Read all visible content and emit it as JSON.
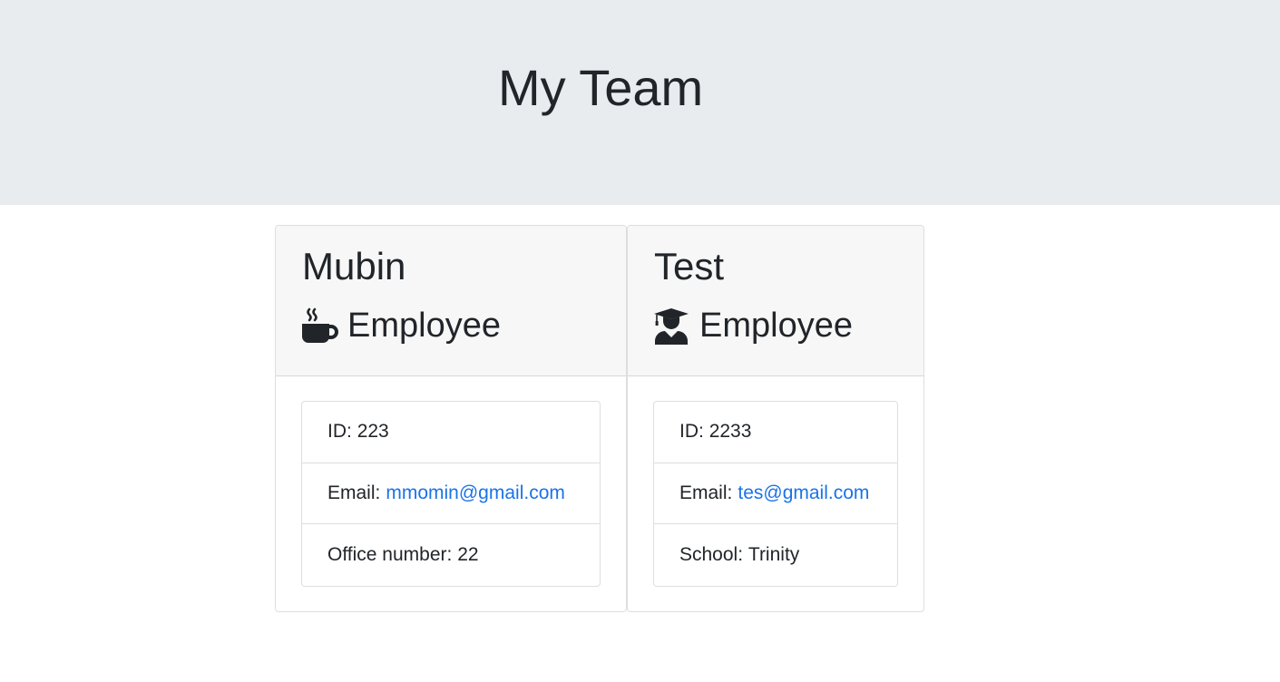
{
  "header": {
    "title": "My Team",
    "background": "#e9ecef"
  },
  "cards": [
    {
      "name": "Mubin",
      "role_icon": "coffee-icon",
      "role": "Employee",
      "id_label": "ID:",
      "id_value": "223",
      "email_label": "Email:",
      "email": "mmomin@gmail.com",
      "extra_label": "Office number:",
      "extra_value": "22"
    },
    {
      "name": "Test",
      "role_icon": "user-graduate-icon",
      "role": "Employee",
      "id_label": "ID:",
      "id_value": "2233",
      "email_label": "Email:",
      "email": "tes@gmail.com",
      "extra_label": "School:",
      "extra_value": "Trinity"
    }
  ],
  "colors": {
    "link": "#1a73e8",
    "text": "#212529",
    "card_header": "#f7f7f7"
  }
}
